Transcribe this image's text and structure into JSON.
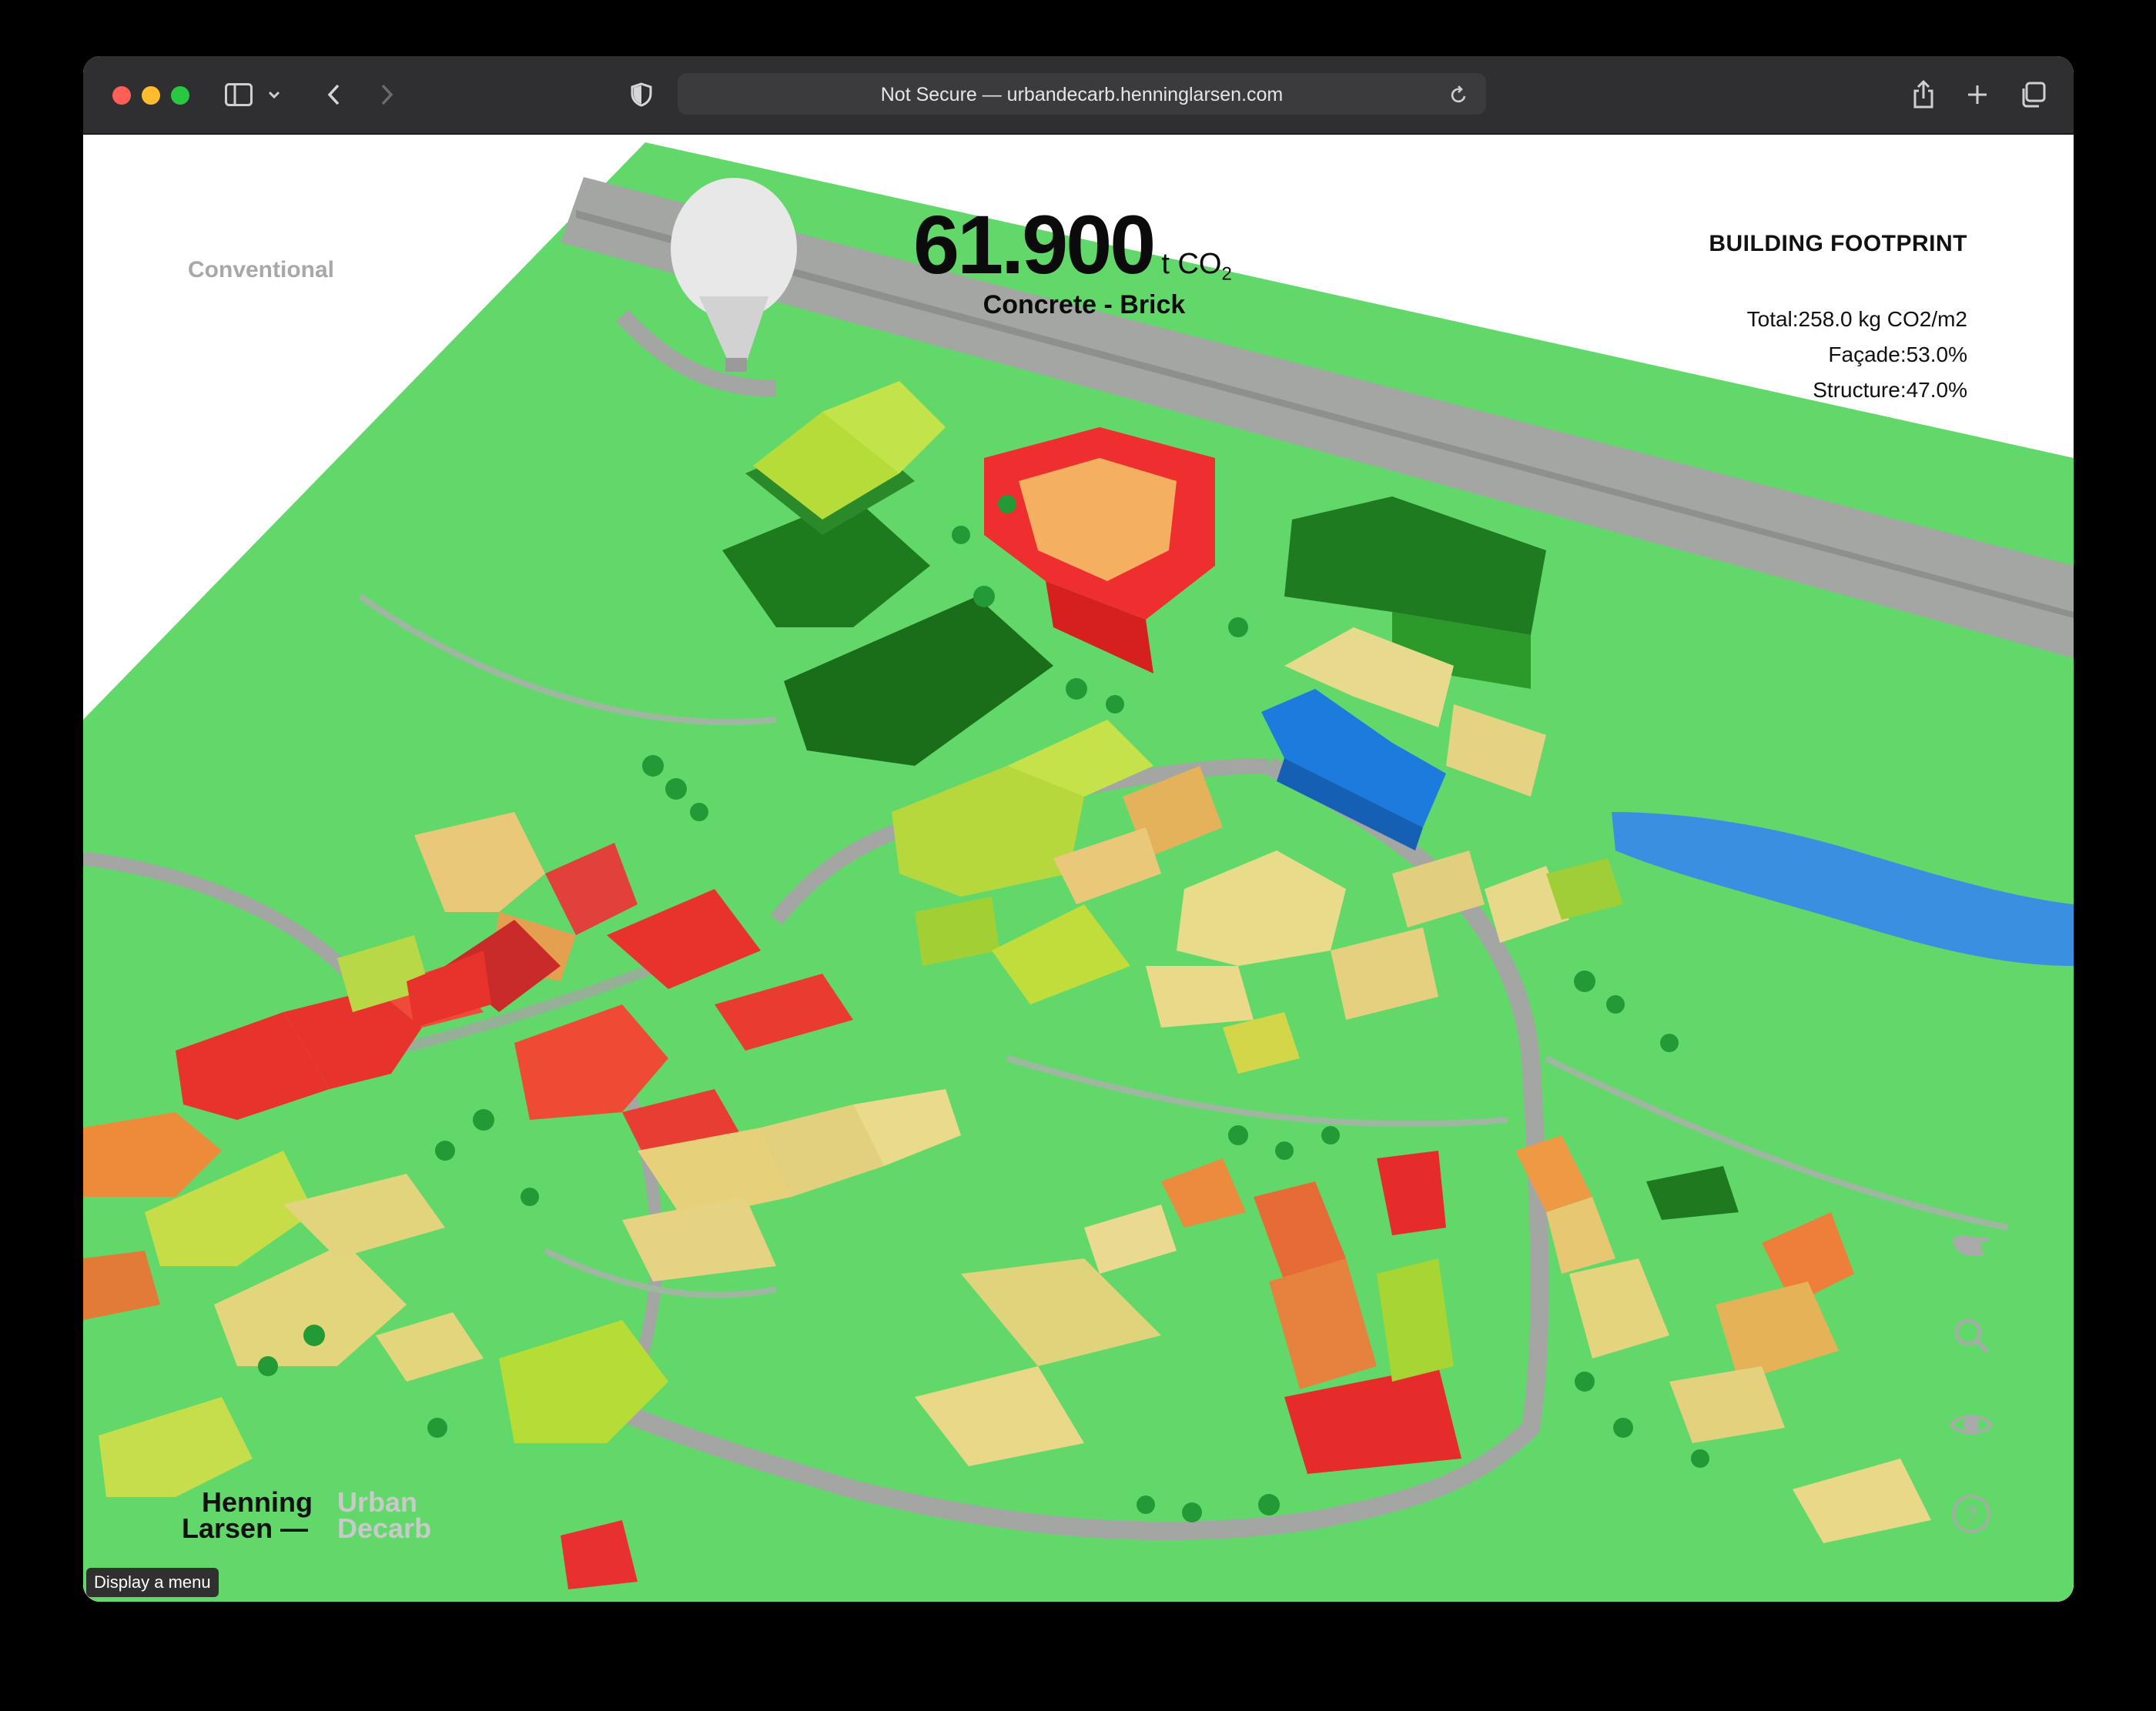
{
  "browser": {
    "url_text": "Not Secure — urbandecarb.henninglarsen.com"
  },
  "app": {
    "scenario_label": "Conventional",
    "co2_value": "61.900",
    "co2_unit_prefix": "t CO",
    "co2_unit_sub": "2",
    "material_label": "Concrete - Brick",
    "panel_title": "BUILDING FOOTPRINT",
    "stats": [
      "Total:258.0 kg CO2/m2",
      "Façade:53.0%",
      "Structure:47.0%"
    ],
    "logo_line1": "Henning",
    "logo_line2": "Larsen —",
    "logo_sub1": "Urban",
    "logo_sub2": "Decarb",
    "menu_button": "Display a menu"
  },
  "icons": [
    "sidebar-icon",
    "chevron-down-icon",
    "back-icon",
    "forward-icon",
    "shield-icon",
    "reload-icon",
    "share-icon",
    "plus-icon",
    "tabs-icon",
    "hand-icon",
    "search-icon",
    "eye-icon",
    "help-icon"
  ],
  "colors": {
    "ground": "#62d86a",
    "road": "#a9aaa8",
    "dark_green_building": "#1d7a1d",
    "red_building": "#ef2f2f",
    "blue_building": "#1e7bde",
    "water": "#3b8fe0"
  }
}
